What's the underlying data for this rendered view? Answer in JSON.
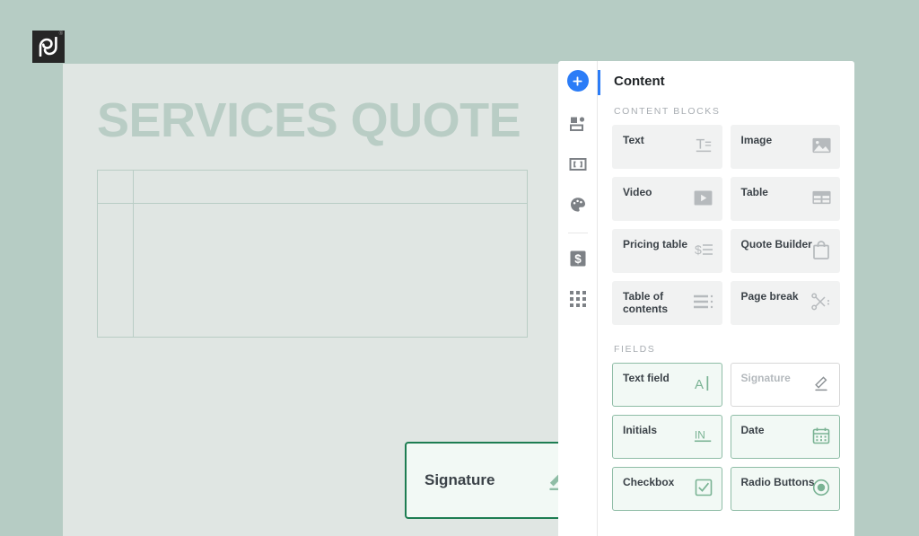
{
  "brand": {
    "logo_name": "pandadoc-logo",
    "logo_text": "pd",
    "registered_mark": "®",
    "accent_blue": "#2b7cf7",
    "accent_green": "#1d7d52",
    "page_background": "#b6ccc4",
    "document_background": "#e0e6e3"
  },
  "document": {
    "title": "SERVICES QUOTE",
    "table_placeholder": "",
    "dragged_block": {
      "label": "Signature",
      "icon": "signature-pen-icon"
    }
  },
  "rail": {
    "items": [
      {
        "name": "add-block",
        "icon": "plus-icon"
      },
      {
        "name": "content-library",
        "icon": "content-blocks-icon"
      },
      {
        "name": "variables",
        "icon": "variables-brackets-icon"
      },
      {
        "name": "theme",
        "icon": "palette-icon"
      },
      {
        "name": "pricing",
        "icon": "dollar-icon"
      },
      {
        "name": "apps",
        "icon": "grid-apps-icon"
      }
    ]
  },
  "panel": {
    "title": "Content",
    "sections": [
      {
        "key": "content_blocks",
        "label": "CONTENT BLOCKS",
        "cards": [
          {
            "label": "Text",
            "icon": "text-icon"
          },
          {
            "label": "Image",
            "icon": "image-icon"
          },
          {
            "label": "Video",
            "icon": "video-play-icon"
          },
          {
            "label": "Table",
            "icon": "table-icon"
          },
          {
            "label": "Pricing table",
            "icon": "pricing-list-icon"
          },
          {
            "label": "Quote Builder",
            "icon": "shopping-bag-icon"
          },
          {
            "label": "Table of contents",
            "icon": "toc-icon"
          },
          {
            "label": "Page break",
            "icon": "scissors-icon"
          }
        ]
      },
      {
        "key": "fields",
        "label": "FIELDS",
        "cards": [
          {
            "label": "Text field",
            "icon": "text-cursor-icon",
            "state": "active"
          },
          {
            "label": "Signature",
            "icon": "signature-pen-icon",
            "state": "ghost"
          },
          {
            "label": "Initials",
            "icon": "initials-in-icon",
            "state": "active"
          },
          {
            "label": "Date",
            "icon": "calendar-icon",
            "state": "active"
          },
          {
            "label": "Checkbox",
            "icon": "checkbox-icon",
            "state": "active"
          },
          {
            "label": "Radio Buttons",
            "icon": "radio-button-icon",
            "state": "active"
          }
        ]
      }
    ]
  }
}
